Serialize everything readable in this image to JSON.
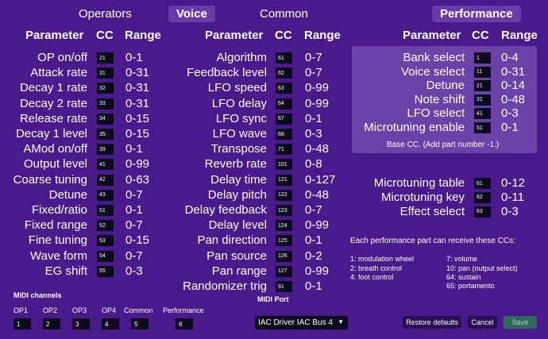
{
  "tabs": [
    "Operators",
    "Voice",
    "Common",
    "Performance"
  ],
  "headers": {
    "parameter": "Parameter",
    "cc": "CC",
    "range": "Range"
  },
  "operators": [
    {
      "p": "OP on/off",
      "cc": "21",
      "r": "0-1"
    },
    {
      "p": "Attack rate",
      "cc": "31",
      "r": "0-31"
    },
    {
      "p": "Decay 1 rate",
      "cc": "32",
      "r": "0-31"
    },
    {
      "p": "Decay 2 rate",
      "cc": "33",
      "r": "0-31"
    },
    {
      "p": "Release rate",
      "cc": "34",
      "r": "0-15"
    },
    {
      "p": "Decay 1 level",
      "cc": "35",
      "r": "0-15"
    },
    {
      "p": "AMod on/off",
      "cc": "39",
      "r": "0-1"
    },
    {
      "p": "Output level",
      "cc": "41",
      "r": "0-99"
    },
    {
      "p": "Coarse tuning",
      "cc": "42",
      "r": "0-63"
    },
    {
      "p": "Detune",
      "cc": "43",
      "r": "0-7"
    },
    {
      "p": "Fixed/ratio",
      "cc": "51",
      "r": "0-1"
    },
    {
      "p": "Fixed range",
      "cc": "52",
      "r": "0-7"
    },
    {
      "p": "Fine tuning",
      "cc": "53",
      "r": "0-15"
    },
    {
      "p": "Wave form",
      "cc": "54",
      "r": "0-7"
    },
    {
      "p": "EG shift",
      "cc": "55",
      "r": "0-3"
    }
  ],
  "common": [
    {
      "p": "Algorithm",
      "cc": "61",
      "r": "0-7"
    },
    {
      "p": "Feedback level",
      "cc": "62",
      "r": "0-7"
    },
    {
      "p": "LFO speed",
      "cc": "63",
      "r": "0-99"
    },
    {
      "p": "LFO delay",
      "cc": "64",
      "r": "0-99"
    },
    {
      "p": "LFO sync",
      "cc": "67",
      "r": "0-1"
    },
    {
      "p": "LFO wave",
      "cc": "68",
      "r": "0-3"
    },
    {
      "p": "Transpose",
      "cc": "71",
      "r": "0-48"
    },
    {
      "p": "Reverb rate",
      "cc": "101",
      "r": "0-8"
    },
    {
      "p": "Delay time",
      "cc": "121",
      "r": "0-127"
    },
    {
      "p": "Delay pitch",
      "cc": "122",
      "r": "0-48"
    },
    {
      "p": "Delay feedback",
      "cc": "123",
      "r": "0-7"
    },
    {
      "p": "Delay level",
      "cc": "124",
      "r": "0-99"
    },
    {
      "p": "Pan direction",
      "cc": "125",
      "r": "0-1"
    },
    {
      "p": "Pan source",
      "cc": "126",
      "r": "0-2"
    },
    {
      "p": "Pan range",
      "cc": "127",
      "r": "0-99"
    },
    {
      "p": "Randomizer trig",
      "cc": "91",
      "r": "0-1"
    }
  ],
  "performance": [
    {
      "p": "Bank select",
      "cc": "1",
      "r": "0-4"
    },
    {
      "p": "Voice select",
      "cc": "11",
      "r": "0-31"
    },
    {
      "p": "Detune",
      "cc": "21",
      "r": "0-14"
    },
    {
      "p": "Note shift",
      "cc": "31",
      "r": "0-48"
    },
    {
      "p": "LFO select",
      "cc": "41",
      "r": "0-3"
    },
    {
      "p": "Microtuning enable",
      "cc": "51",
      "r": "0-1"
    }
  ],
  "perf_note": "Base CC. (Add part number -1.)",
  "performance2": [
    {
      "p": "Microtuning table",
      "cc": "61",
      "r": "0-12"
    },
    {
      "p": "Microtuning key",
      "cc": "62",
      "r": "0-11"
    },
    {
      "p": "Effect select",
      "cc": "63",
      "r": "0-3"
    }
  ],
  "part_cc_title": "Each performance part can receive these CCs:",
  "part_cc_left": [
    "1: modulation wheel",
    "2: breath control",
    "4: foot control"
  ],
  "part_cc_right": [
    "7: volume",
    "10: pan (output select)",
    "64: sustain",
    "65: portamento"
  ],
  "midi_channels": {
    "title": "MIDI channels",
    "items": [
      {
        "label": "OP1",
        "value": "1"
      },
      {
        "label": "OP2",
        "value": "2"
      },
      {
        "label": "OP3",
        "value": "3"
      },
      {
        "label": "OP4",
        "value": "4"
      },
      {
        "label": "Common",
        "value": "5"
      },
      {
        "label": "Performance",
        "value": "6"
      }
    ]
  },
  "midi_port": {
    "title": "MIDI Port",
    "value": "IAC Driver IAC Bus 4"
  },
  "buttons": {
    "restore": "Restore defaults",
    "cancel": "Cancel",
    "save": "Save"
  }
}
